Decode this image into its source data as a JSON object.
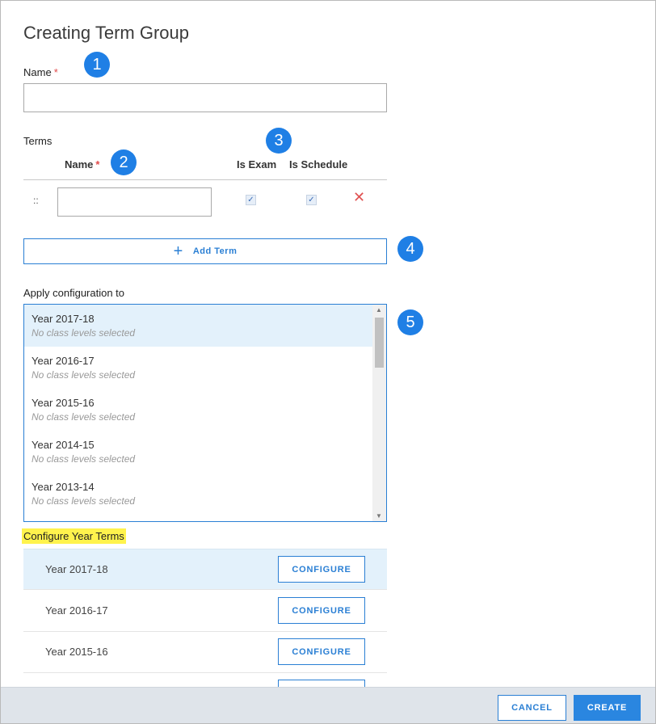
{
  "dialog": {
    "title": "Creating Term Group"
  },
  "name_field": {
    "label": "Name",
    "required_mark": "*",
    "value": "",
    "placeholder": ""
  },
  "terms": {
    "label": "Terms",
    "columns": {
      "name": "Name",
      "required_mark": "*",
      "is_exam": "Is Exam",
      "is_schedule": "Is Schedule"
    },
    "rows": [
      {
        "drag_handle": "::",
        "name": "",
        "is_exam": true,
        "is_schedule": true,
        "check_glyph": "✓",
        "delete_glyph": "✕"
      }
    ],
    "add_button": {
      "icon": "plus-icon",
      "glyph": "+",
      "label": "Add Term"
    }
  },
  "apply_config": {
    "label": "Apply configuration to",
    "items": [
      {
        "title": "Year 2017-18",
        "subtitle": "No class levels selected",
        "selected": true
      },
      {
        "title": "Year 2016-17",
        "subtitle": "No class levels selected",
        "selected": false
      },
      {
        "title": "Year 2015-16",
        "subtitle": "No class levels selected",
        "selected": false
      },
      {
        "title": "Year 2014-15",
        "subtitle": "No class levels selected",
        "selected": false
      },
      {
        "title": "Year 2013-14",
        "subtitle": "No class levels selected",
        "selected": false
      }
    ],
    "scroll": {
      "up_glyph": "▲",
      "down_glyph": "▼"
    }
  },
  "configure_year_terms": {
    "label": "Configure Year Terms",
    "highlight_color": "#fff34d",
    "rows": [
      {
        "year": "Year 2017-18",
        "button": "CONFIGURE",
        "selected": true
      },
      {
        "year": "Year 2016-17",
        "button": "CONFIGURE",
        "selected": false
      },
      {
        "year": "Year 2015-16",
        "button": "CONFIGURE",
        "selected": false
      },
      {
        "year": "",
        "button": "",
        "selected": false
      }
    ]
  },
  "markers": [
    "1",
    "2",
    "3",
    "4",
    "5"
  ],
  "footer": {
    "cancel_label": "CANCEL",
    "create_label": "CREATE"
  },
  "colors": {
    "accent": "#2a7fd4",
    "marker": "#1f7fe5",
    "selected_bg": "#e3f1fb",
    "required": "#e04a4a",
    "delete": "#e05252"
  }
}
